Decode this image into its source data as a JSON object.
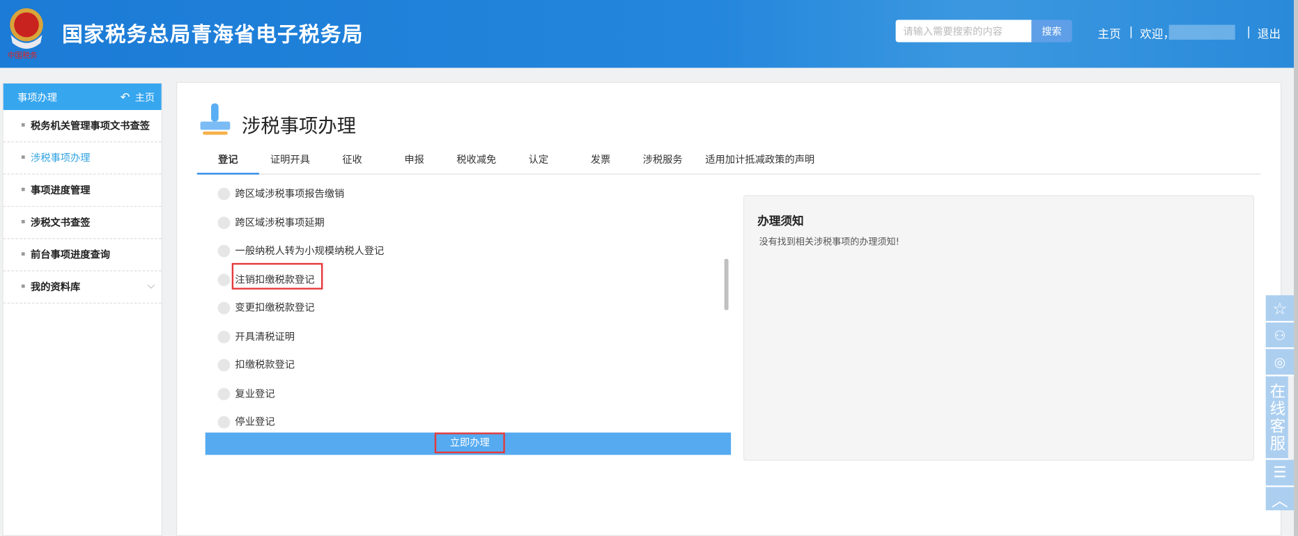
{
  "header": {
    "title": "国家税务总局青海省电子税务局",
    "search_placeholder": "请输入需要搜索的内容",
    "search_button": "搜索",
    "home": "主页",
    "sep": "|",
    "welcome": "欢迎，",
    "logout": "退出"
  },
  "sidebar": {
    "title": "事项办理",
    "home_link": "主页",
    "items": [
      {
        "label": "税务机关管理事项文书查签"
      },
      {
        "label": "涉税事项办理"
      },
      {
        "label": "事项进度管理"
      },
      {
        "label": "涉税文书查签"
      },
      {
        "label": "前台事项进度查询"
      },
      {
        "label": "我的资料库"
      }
    ]
  },
  "main": {
    "title": "涉税事项办理",
    "tabs": [
      {
        "label": "登记"
      },
      {
        "label": "证明开具"
      },
      {
        "label": "征收"
      },
      {
        "label": "申报"
      },
      {
        "label": "税收减免"
      },
      {
        "label": "认定"
      },
      {
        "label": "发票"
      },
      {
        "label": "涉税服务"
      },
      {
        "label": "适用加计抵减政策的声明"
      }
    ],
    "items": [
      {
        "label": "跨区域涉税事项报告缴销"
      },
      {
        "label": "跨区域涉税事项延期"
      },
      {
        "label": "一般纳税人转为小规模纳税人登记"
      },
      {
        "label": "注销扣缴税款登记"
      },
      {
        "label": "变更扣缴税款登记"
      },
      {
        "label": "开具清税证明"
      },
      {
        "label": "扣缴税款登记"
      },
      {
        "label": "复业登记"
      },
      {
        "label": "停业登记"
      }
    ],
    "action_button": "立即办理",
    "notice": {
      "title": "办理须知",
      "text": "没有找到相关涉税事项的办理须知!"
    }
  },
  "float_bar": {
    "service": "在线客服"
  }
}
